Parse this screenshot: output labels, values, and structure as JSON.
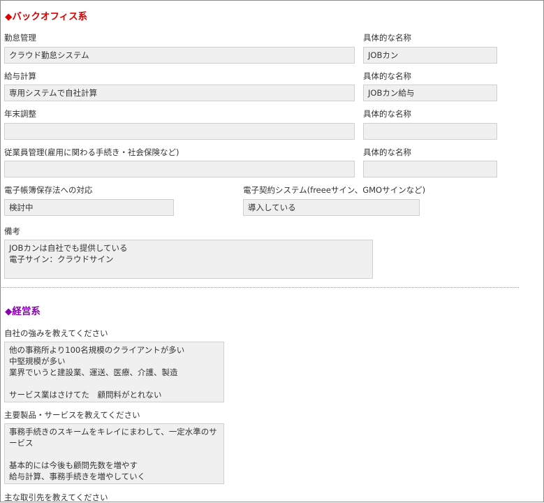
{
  "back_office": {
    "title": "◆バックオフィス系",
    "title_color": "#dd0000",
    "specific_name_label": "具体的な名称",
    "attendance": {
      "label": "勤怠管理",
      "value": "クラウド勤怠システム",
      "name_value": "JOBカン"
    },
    "payroll": {
      "label": "給与計算",
      "value": "専用システムで自社計算",
      "name_value": "JOBカン給与"
    },
    "year_end": {
      "label": "年末調整",
      "value": "",
      "name_value": ""
    },
    "employee_mgmt": {
      "label": "従業員管理(雇用に関わる手続き・社会保険など)",
      "value": "",
      "name_value": ""
    },
    "e_book": {
      "label": "電子帳簿保存法への対応",
      "value": "検討中"
    },
    "e_contract": {
      "label": "電子契約システム(freeeサイン、GMOサインなど)",
      "value": "導入している"
    },
    "remarks": {
      "label": "備考",
      "value": "JOBカンは自社でも提供している\n電子サイン：クラウドサイン"
    }
  },
  "management": {
    "title": "◆経営系",
    "title_color": "#8b00b5",
    "strengths": {
      "label": "自社の強みを教えてください",
      "value": "他の事務所より100名規模のクライアントが多い\n中堅規模が多い\n業界でいうと建設業、運送、医療、介護、製造\n\nサービス業はさけてた　顧問料がとれない"
    },
    "products": {
      "label": "主要製品・サービスを教えてください",
      "value": "事務手続きのスキームをキレイにまわして、一定水準のサービス\n\n基本的には今後も顧問先数を増やす\n給与計算、事務手続きを増やしていく"
    },
    "clients": {
      "label": "主な取引先を教えてください"
    }
  }
}
